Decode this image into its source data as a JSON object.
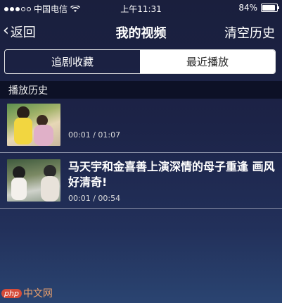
{
  "status_bar": {
    "carrier": "中国电信",
    "time": "上午11:31",
    "battery_percent": "84%",
    "battery_level": 0.84
  },
  "nav": {
    "back_label": "返回",
    "title": "我的视频",
    "clear_label": "清空历史"
  },
  "tabs": [
    {
      "label": "追剧收藏",
      "selected": false
    },
    {
      "label": "最近播放",
      "selected": true
    }
  ],
  "section": {
    "header": "播放历史"
  },
  "history": [
    {
      "title": "",
      "progress": "00:01 / 01:07"
    },
    {
      "title": "马天宇和金喜善上演深情的母子重逢 画风好清奇!",
      "progress": "00:01 / 00:54"
    }
  ],
  "watermark": {
    "logo": "php",
    "text": "中文网"
  },
  "colors": {
    "background_top": "#1a1f3d",
    "background_bottom": "#2a4471",
    "section_header_bg": "#0d1126",
    "segment_active_bg": "#ffffff"
  }
}
